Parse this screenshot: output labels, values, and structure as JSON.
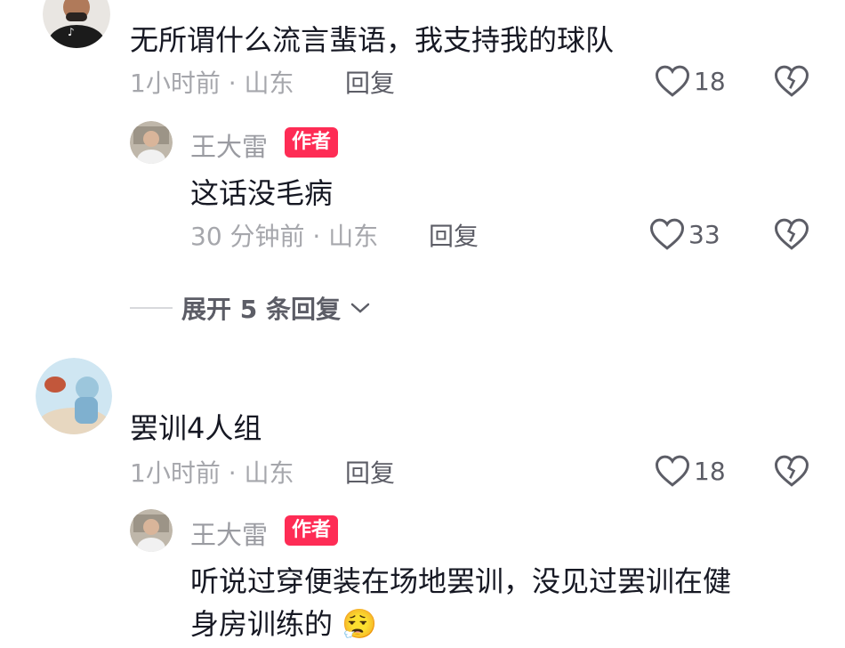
{
  "comments": [
    {
      "text": "无所谓什么流言蜚语，我支持我的球队",
      "meta": "1小时前 · 山东",
      "reply_label": "回复",
      "likes": "18",
      "reply": {
        "name": "王大雷",
        "badge": "作者",
        "text": "这话没毛病",
        "meta": "30 分钟前 · 山东",
        "reply_label": "回复",
        "likes": "33"
      },
      "expand_label": "展开 5 条回复"
    },
    {
      "text": "罢训4人组",
      "meta": "1小时前 · 山东",
      "reply_label": "回复",
      "likes": "18",
      "reply": {
        "name": "王大雷",
        "badge": "作者",
        "text_line1": "听说过穿便装在场地罢训，没见过罢训在健",
        "text_line2": "身房训练的",
        "emoji": "😮‍💨"
      }
    }
  ],
  "colors": {
    "accent": "#fe2c55",
    "text": "#161823",
    "meta": "#a6a7ac"
  },
  "icons": [
    "heart-outline-icon",
    "broken-heart-icon",
    "chevron-down-icon"
  ]
}
